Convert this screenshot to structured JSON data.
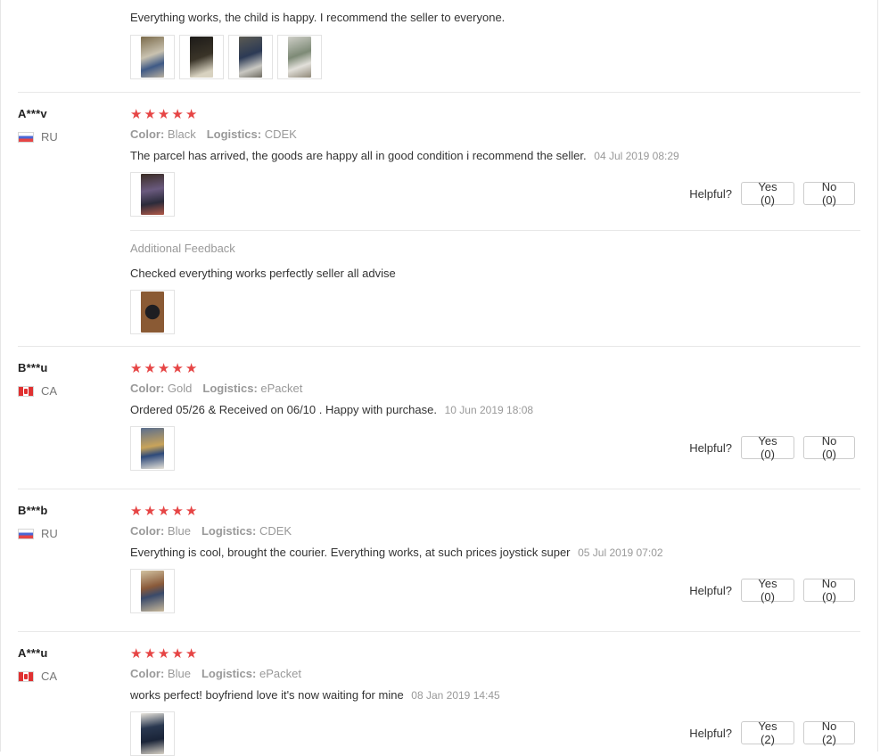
{
  "top": {
    "text": "Everything works, the child is happy. I recommend the seller to everyone.",
    "photos": [
      "photo-1",
      "photo-2",
      "photo-3",
      "photo-4"
    ]
  },
  "labels": {
    "color": "Color:",
    "logistics": "Logistics:",
    "helpful": "Helpful?",
    "additional_feedback": "Additional Feedback"
  },
  "reviews": [
    {
      "user": "A***v",
      "country": "RU",
      "stars": 5,
      "color": "Black",
      "logistics": "CDEK",
      "text": "The parcel has arrived, the goods are happy all in good condition i recommend the seller.",
      "date": "04 Jul 2019 08:29",
      "yes": "Yes (0)",
      "no": "No (0)",
      "additional_text": "Checked everything works perfectly seller all advise"
    },
    {
      "user": "B***u",
      "country": "CA",
      "stars": 5,
      "color": "Gold",
      "logistics": "ePacket",
      "text": "Ordered 05/26 & Received on 06/10 . Happy with purchase.",
      "date": "10 Jun 2019 18:08",
      "yes": "Yes (0)",
      "no": "No (0)"
    },
    {
      "user": "B***b",
      "country": "RU",
      "stars": 5,
      "color": "Blue",
      "logistics": "CDEK",
      "text": "Everything is cool, brought the courier. Everything works, at such prices joystick super",
      "date": "05 Jul 2019 07:02",
      "yes": "Yes (0)",
      "no": "No (0)"
    },
    {
      "user": "A***u",
      "country": "CA",
      "stars": 5,
      "color": "Blue",
      "logistics": "ePacket",
      "text": "works perfect! boyfriend love it's now waiting for mine",
      "date": "08 Jan 2019 14:45",
      "yes": "Yes (2)",
      "no": "No (2)"
    }
  ],
  "colors": {
    "star": "#e64545",
    "muted": "#999999",
    "text": "#333333",
    "divider": "#e8e8e8"
  }
}
